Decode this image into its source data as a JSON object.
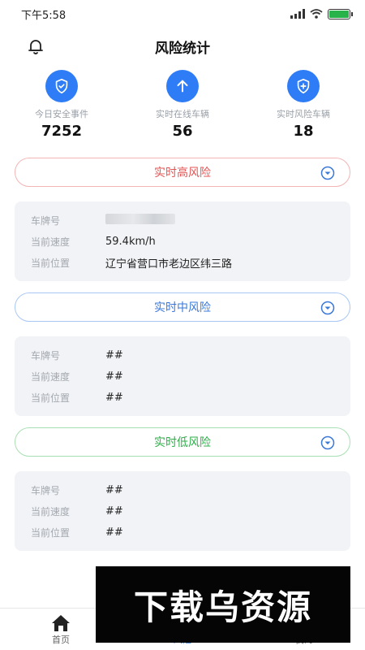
{
  "status_bar": {
    "time": "下午5:58"
  },
  "header": {
    "title": "风险统计",
    "bell_icon": "bell-icon"
  },
  "stats": [
    {
      "icon": "shield-check-icon",
      "label": "今日安全事件",
      "value": "7252"
    },
    {
      "icon": "arrow-up-icon",
      "label": "实时在线车辆",
      "value": "56"
    },
    {
      "icon": "shield-plus-icon",
      "label": "实时风险车辆",
      "value": "18"
    }
  ],
  "sections": [
    {
      "title": "实时高风险",
      "color": "#e25555",
      "rows": [
        {
          "key": "车牌号",
          "value": ""
        },
        {
          "key": "当前速度",
          "value": "59.4km/h"
        },
        {
          "key": "当前位置",
          "value": "辽宁省营口市老边区纬三路"
        }
      ]
    },
    {
      "title": "实时中风险",
      "color": "#3a78d8",
      "rows": [
        {
          "key": "车牌号",
          "value": "##"
        },
        {
          "key": "当前速度",
          "value": "##"
        },
        {
          "key": "当前位置",
          "value": "##"
        }
      ]
    },
    {
      "title": "实时低风险",
      "color": "#2fae4a",
      "rows": [
        {
          "key": "车牌号",
          "value": "##"
        },
        {
          "key": "当前速度",
          "value": "##"
        },
        {
          "key": "当前位置",
          "value": "##"
        }
      ]
    }
  ],
  "tabbar": [
    {
      "label": "首页",
      "icon": "home-icon"
    },
    {
      "label": "风险",
      "icon": "risk-icon"
    },
    {
      "label": "我的",
      "icon": "user-icon"
    }
  ],
  "watermark": {
    "text": "下载乌资源"
  },
  "colors": {
    "accent": "#2f7df6",
    "card_bg": "#f1f3f6"
  }
}
